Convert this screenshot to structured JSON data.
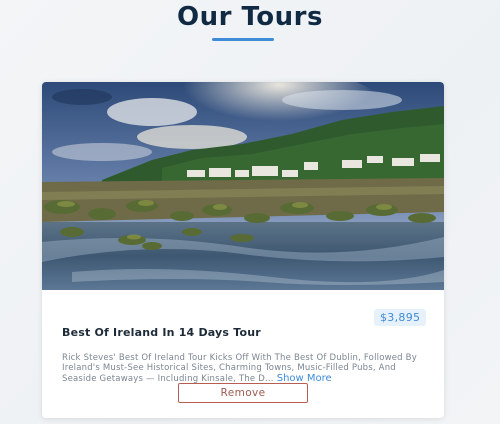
{
  "page": {
    "title": "Our Tours",
    "accent_color": "#3d8bd9",
    "title_color": "#102a43"
  },
  "tours": [
    {
      "name": "Best Of Ireland In 14 Days Tour",
      "price": "$3,895",
      "info": "Rick Steves' Best Of Ireland Tour Kicks Off With The Best Of Dublin, Followed By Ireland's Must-See Historical Sites, Charming Towns, Music-Filled Pubs, And Seaside Getaways — Including Kinsale, The D...",
      "show_more_label": "Show More",
      "remove_label": "Remove",
      "remove_color": "#b55f52"
    }
  ]
}
